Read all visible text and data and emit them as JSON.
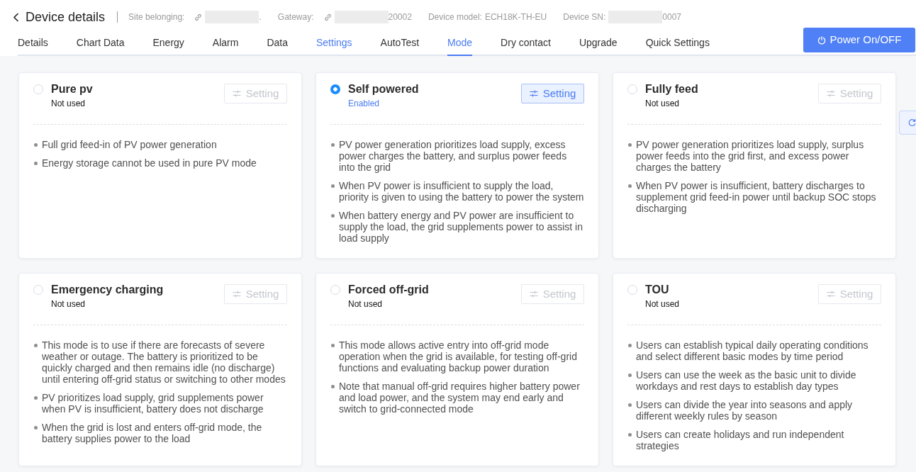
{
  "header": {
    "title": "Device details",
    "meta": [
      {
        "label": "Site belonging:",
        "link": true,
        "redacted": true,
        "value": "."
      },
      {
        "label": "Gateway:",
        "link": true,
        "redacted": true,
        "value": "20002"
      },
      {
        "label": "Device model:",
        "link": false,
        "redacted": false,
        "value": "ECH18K-TH-EU"
      },
      {
        "label": "Device SN:",
        "link": false,
        "redacted": true,
        "value": "0007"
      }
    ]
  },
  "tabs": [
    {
      "label": "Details",
      "selected": false,
      "hovered": false
    },
    {
      "label": "Chart Data",
      "selected": false,
      "hovered": false
    },
    {
      "label": "Energy",
      "selected": false,
      "hovered": false
    },
    {
      "label": "Alarm",
      "selected": false,
      "hovered": false
    },
    {
      "label": "Data",
      "selected": false,
      "hovered": false
    },
    {
      "label": "Settings",
      "selected": false,
      "hovered": true
    },
    {
      "label": "AutoTest",
      "selected": false,
      "hovered": false
    },
    {
      "label": "Mode",
      "selected": true,
      "hovered": false
    },
    {
      "label": "Dry contact",
      "selected": false,
      "hovered": false
    },
    {
      "label": "Upgrade",
      "selected": false,
      "hovered": false
    },
    {
      "label": "Quick Settings",
      "selected": false,
      "hovered": false
    }
  ],
  "power_button": {
    "label": "Power On/OFF"
  },
  "modes": [
    {
      "title": "Pure pv",
      "status": "Not used",
      "selected": false,
      "setting": {
        "label": "Setting",
        "disabled": true
      },
      "bullets": [
        "Full grid feed-in of PV power generation",
        "Energy storage cannot be used in pure PV mode"
      ]
    },
    {
      "title": "Self powered",
      "status": "Enabled",
      "selected": true,
      "setting": {
        "label": "Setting",
        "disabled": false
      },
      "bullets": [
        "PV power generation prioritizes load supply, excess power charges the battery, and surplus power feeds into the grid",
        "When PV power is insufficient to supply the load, priority is given to using the battery to power the system",
        "When battery energy and PV power are insufficient to supply the load, the grid supplements power to assist in load supply"
      ]
    },
    {
      "title": "Fully feed",
      "status": "Not used",
      "selected": false,
      "setting": {
        "label": "Setting",
        "disabled": true
      },
      "bullets": [
        "PV power generation prioritizes load supply, surplus power feeds into the grid first, and excess power charges the battery",
        "When PV power is insufficient, battery discharges to supplement grid feed-in power until backup SOC stops discharging"
      ]
    },
    {
      "title": "Emergency charging",
      "status": "Not used",
      "selected": false,
      "setting": {
        "label": "Setting",
        "disabled": true
      },
      "bullets": [
        "This mode is to use if there are forecasts of severe weather or outage. The battery is prioritized to be quickly charged and then remains idle (no discharge) until entering off-grid status or switching to other modes",
        "PV prioritizes load supply, grid supplements power when PV is insufficient, battery does not discharge",
        "When the grid is lost and enters off-grid mode, the battery supplies power to the load"
      ]
    },
    {
      "title": "Forced off-grid",
      "status": "Not used",
      "selected": false,
      "setting": {
        "label": "Setting",
        "disabled": true
      },
      "bullets": [
        "This mode allows active entry into off-grid mode operation when the grid is available, for testing off-grid functions and evaluating backup power duration",
        "Note that manual off-grid requires higher battery power and load power, and the system may end early and switch to grid-connected mode"
      ]
    },
    {
      "title": "TOU",
      "status": "Not used",
      "selected": false,
      "setting": {
        "label": "Setting",
        "disabled": true
      },
      "bullets": [
        "Users can establish typical daily operating conditions and select different basic modes by time period",
        "Users can use the week as the basic unit to divide workdays and rest days to establish day types",
        "Users can divide the year into seasons and apply different weekly rules by season",
        "Users can create holidays and run independent strategies"
      ]
    }
  ]
}
